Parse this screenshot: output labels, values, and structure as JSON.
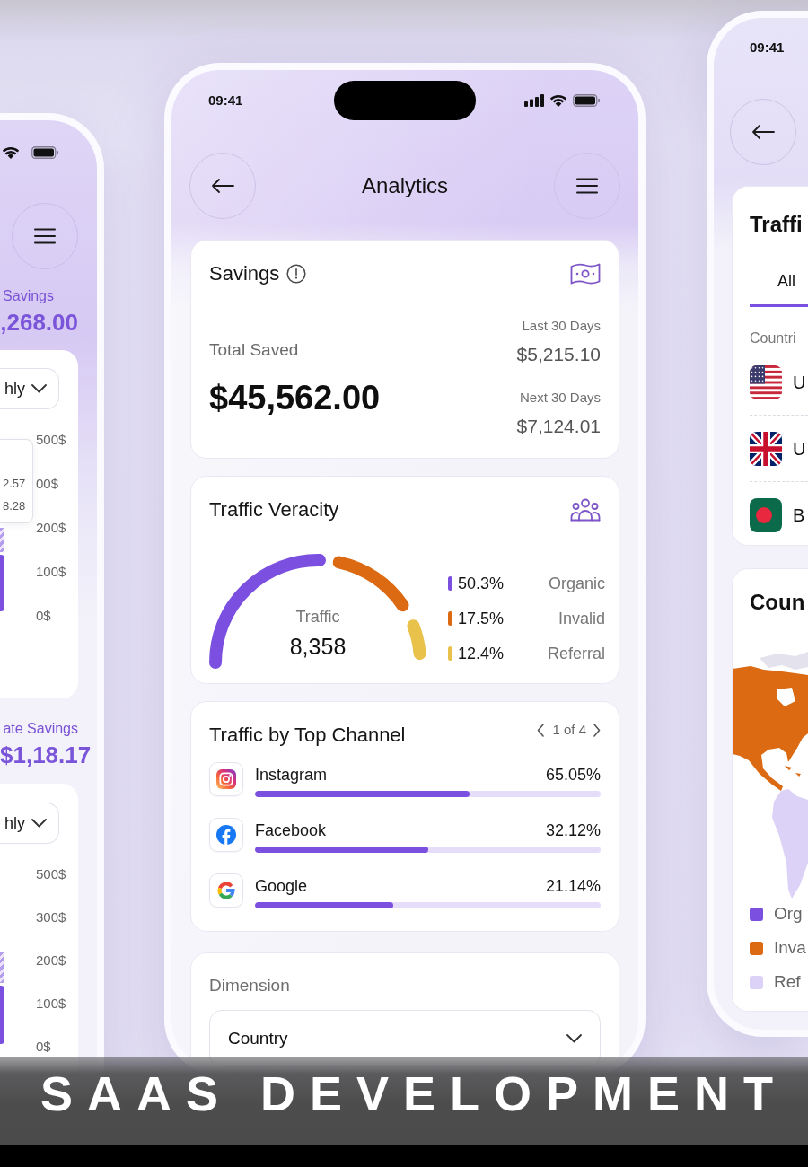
{
  "left_phone": {
    "sections": [
      {
        "label": "Savings",
        "amount": ",268.00",
        "period": "hly",
        "tooltip": [
          "2.57",
          "8.28"
        ],
        "y_axis": [
          "500$",
          "00$",
          "200$",
          "100$",
          "0$"
        ]
      },
      {
        "label": "ate Savings",
        "amount": "$1,18.17",
        "period": "hly",
        "y_axis": [
          "500$",
          "300$",
          "200$",
          "100$",
          "0$"
        ]
      }
    ]
  },
  "center_phone": {
    "status_bar": {
      "time": "09:41"
    },
    "header": {
      "title": "Analytics"
    },
    "savings": {
      "title": "Savings",
      "total_label": "Total Saved",
      "total": "$45,562.00",
      "periods": [
        {
          "label": "Last 30 Days",
          "amount": "$5,215.10"
        },
        {
          "label": "Next 30 Days",
          "amount": "$7,124.01"
        }
      ]
    },
    "traffic_veracity": {
      "title": "Traffic Veracity",
      "center_label": "Traffic",
      "center_value": "8,358",
      "segments": [
        {
          "percent": "50.3%",
          "label": "Organic",
          "color": "#7b4fe0"
        },
        {
          "percent": "17.5%",
          "label": "Invalid",
          "color": "#dc6a12"
        },
        {
          "percent": "12.4%",
          "label": "Referral",
          "color": "#e9c24c"
        }
      ]
    },
    "top_channels": {
      "title": "Traffic by Top Channel",
      "pager": "1 of 4",
      "channels": [
        {
          "name": "Instagram",
          "percent": "65.05%",
          "level": 0.62
        },
        {
          "name": "Facebook",
          "percent": "32.12%",
          "level": 0.5
        },
        {
          "name": "Google",
          "percent": "21.14%",
          "level": 0.4
        }
      ]
    },
    "dimension": {
      "label": "Dimension",
      "value": "Country"
    }
  },
  "right_phone": {
    "status_bar": {
      "time": "09:41"
    },
    "traffic_card": {
      "title": "Traffi",
      "tabs": [
        {
          "label": "All",
          "selected": true
        }
      ],
      "column_label": "Countri",
      "rows": [
        {
          "name": "U"
        },
        {
          "name": "U"
        },
        {
          "name": "B"
        }
      ]
    },
    "country_card": {
      "title": "Coun",
      "legend": [
        {
          "label": "Org",
          "color": "#7b4fe0"
        },
        {
          "label": "Inva",
          "color": "#dc6a12"
        },
        {
          "label": "Ref",
          "color": "#dcd2f7"
        }
      ]
    }
  },
  "banner": {
    "text": "SAAS DEVELOPMENT"
  }
}
